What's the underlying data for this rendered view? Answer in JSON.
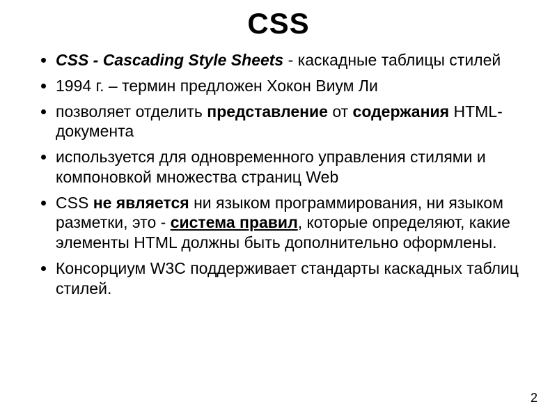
{
  "title": "CSS",
  "bullets": [
    {
      "b0_boldital": "CSS - Cascading Style Sheets",
      "b0_rest": " - каскадные таблицы стилей"
    },
    {
      "b1_text": "1994 г. – термин предложен Хокон Виум Ли"
    },
    {
      "b2_pre": "позволяет отделить ",
      "b2_bold1": "представление",
      "b2_mid": " от ",
      "b2_bold2": "содержания",
      "b2_post": " HTML-документа"
    },
    {
      "b3_text": "используется для одновременного управления стилями и компоновкой множества страниц Web"
    },
    {
      "b4_pre": "CSS ",
      "b4_bold1": "не является",
      "b4_mid": " ни языком программирования, ни языком разметки, это - ",
      "b4_boldul": "система правил",
      "b4_post": ", которые определяют, какие элементы HTML должны быть дополнительно оформлены."
    },
    {
      "b5_text": "Консорциум W3C поддерживает стандарты каскадных таблиц стилей."
    }
  ],
  "page_number": "2"
}
